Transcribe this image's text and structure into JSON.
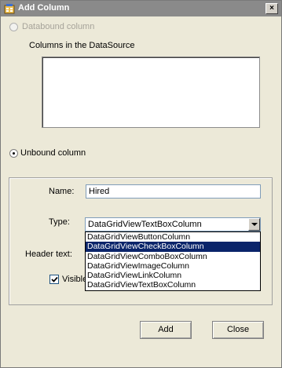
{
  "window": {
    "title": "Add Column",
    "close_glyph": "×"
  },
  "databound": {
    "label": "Databound column",
    "enabled": false,
    "columns_label": "Columns in the DataSource"
  },
  "unbound": {
    "label": "Unbound column",
    "checked": true
  },
  "form": {
    "name_label": "Name:",
    "name_value": "Hired",
    "type_label": "Type:",
    "type_value": "DataGridViewTextBoxColumn",
    "header_text_label": "Header text:",
    "visible_label": "Visible",
    "visible_checked": true
  },
  "dropdown": {
    "items": [
      "DataGridViewButtonColumn",
      "DataGridViewCheckBoxColumn",
      "DataGridViewComboBoxColumn",
      "DataGridViewImageColumn",
      "DataGridViewLinkColumn",
      "DataGridViewTextBoxColumn"
    ],
    "selected_index": 1
  },
  "buttons": {
    "add_label": "Add",
    "close_label": "Close"
  },
  "colors": {
    "dialog_bg": "#ece9d8",
    "titlebar_bg": "#8a8a8a",
    "selection_bg": "#0a246a",
    "selection_text": "#ffffff"
  }
}
